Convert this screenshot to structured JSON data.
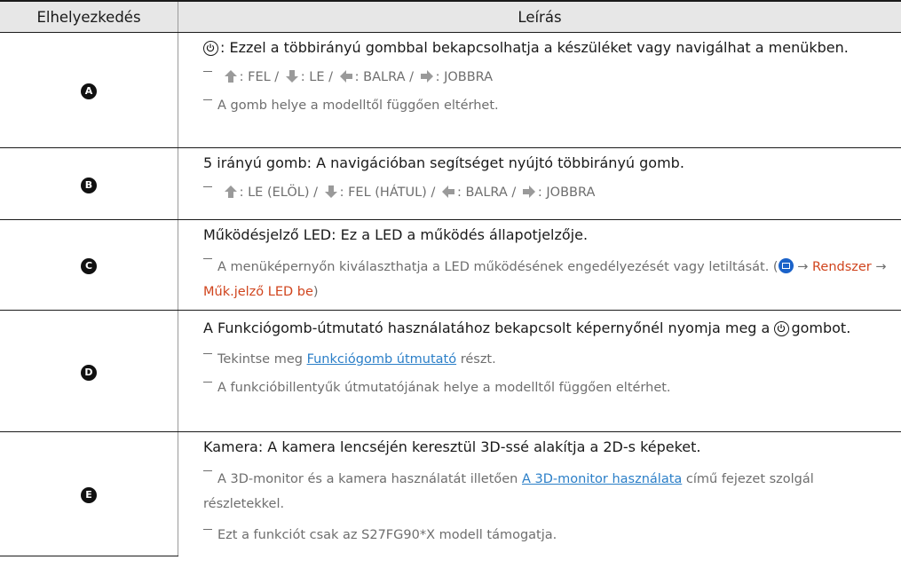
{
  "table": {
    "col_location": "Elhelyezkedés",
    "col_description": "Leírás"
  },
  "rows": {
    "a": {
      "badge": "A",
      "main": ": Ezzel a többirányú gombbal bekapcsolhatja a készüléket vagy navigálhat a menükben.",
      "n1_up": ": FEL /",
      "n1_down": ": LE /",
      "n1_left": ": BALRA /",
      "n1_right": ": JOBBRA",
      "note2": "A gomb helye a modelltől függően eltérhet."
    },
    "b": {
      "badge": "B",
      "main": "5 irányú gomb: A navigációban segítséget nyújtó többirányú gomb.",
      "n1_up": ": LE (ELÖL) /",
      "n1_down": ": FEL (HÁTUL) /",
      "n1_left": ": BALRA /",
      "n1_right": ": JOBBRA"
    },
    "c": {
      "badge": "C",
      "main_term": "Működésjelző LED",
      "main_rest": ": Ez a LED a működés állapotjelzője.",
      "note_text": "A menüképernyőn kiválaszthatja a LED működésének engedélyezését vagy letiltását. (",
      "note_arrow1": " → ",
      "note_menu": "Rendszer",
      "note_arrow2": " → ",
      "note_item": "Műk.jelző LED be",
      "note_close": ")"
    },
    "d": {
      "badge": "D",
      "main_pre": "A Funkciógomb-útmutató használatához bekapcsolt képernyőnél nyomja meg a ",
      "main_post": "gombot.",
      "n1_pre": "Tekintse meg ",
      "n1_link": "Funkciógomb útmutató",
      "n1_post": " részt.",
      "note2": "A funkcióbillentyűk útmutatójának helye a modelltől függően eltérhet."
    },
    "e": {
      "badge": "E",
      "main_term": "Kamera",
      "main_rest": ": A kamera lencséjén keresztül 3D-ssé alakítja a 2D-s képeket.",
      "n1_pre": "A 3D-monitor és a kamera használatát illetően ",
      "n1_link": "A 3D-monitor használata",
      "n1_post": " című fejezet szolgál részletekkel.",
      "note2": "Ezt a funkciót csak az S27FG90*X modell támogatja."
    }
  },
  "icons": {
    "power": "power-icon",
    "up": "arrow-up-icon",
    "down": "arrow-down-icon",
    "left": "arrow-left-icon",
    "right": "arrow-right-icon",
    "menu": "menu-icon"
  },
  "colors": {
    "accent_red": "#d0441d",
    "link_blue": "#2b7fc8",
    "header_bg": "#e7e7e7"
  }
}
